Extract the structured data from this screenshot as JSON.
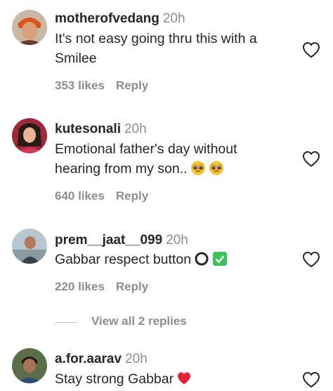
{
  "comments": [
    {
      "username": "motherofvedang",
      "time": "20h",
      "text_lines": [
        "It's not easy going thru this with a",
        "Smilee"
      ],
      "likes": "353 likes",
      "reply": "Reply"
    },
    {
      "username": "kutesonali",
      "time": "20h",
      "text_lines": [
        "Emotional father's day without",
        "hearing from my son.."
      ],
      "emojis": [
        "pleading-face",
        "pleading-face"
      ],
      "likes": "640 likes",
      "reply": "Reply"
    },
    {
      "username": "prem__jaat__099",
      "time": "20h",
      "text_lines": [
        "Gabbar respect button"
      ],
      "emojis": [
        "hollow-circle",
        "check-mark-button"
      ],
      "likes": "220 likes",
      "reply": "Reply"
    },
    {
      "username": "a.for.aarav",
      "time": "20h",
      "text_lines": [
        "Stay strong Gabbar"
      ],
      "emojis": [
        "red-heart"
      ]
    }
  ],
  "view_replies": "View all 2 replies",
  "icons": {
    "like": "heart-outline-icon"
  },
  "colors": {
    "text": "#262626",
    "secondary": "#8e8e8e",
    "check_green": "#3ec15a",
    "heart_red": "#e0243a"
  }
}
